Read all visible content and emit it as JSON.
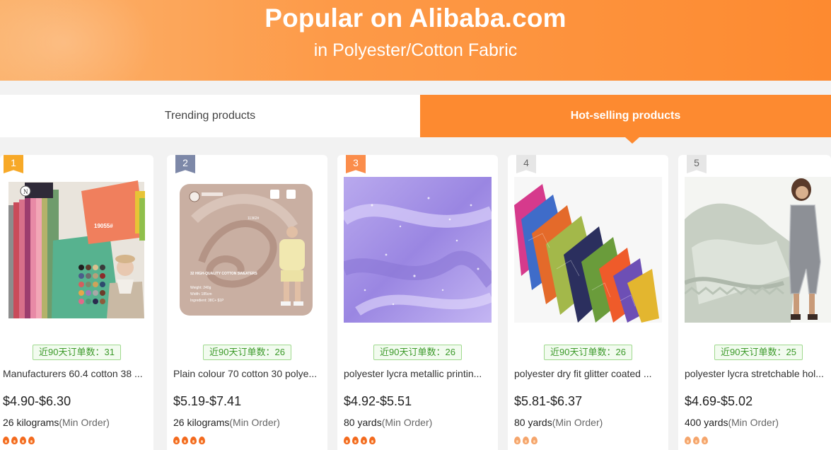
{
  "banner": {
    "title": "Popular on Alibaba.com",
    "subtitle": "in Polyester/Cotton Fabric"
  },
  "tabs": [
    {
      "label": "Trending products",
      "active": false
    },
    {
      "label": "Hot-selling products",
      "active": true
    }
  ],
  "colors": {
    "accent": "#fd8a30",
    "badge_green": "#3c9a2a",
    "flame": "#f36a1e"
  },
  "products": [
    {
      "rank": "1",
      "orders": "近90天订单数：31",
      "title": "Manufacturers 60.4 cotton 38 ...",
      "price": "$4.90-$6.30",
      "min_qty": "26 kilograms",
      "min_label": "(Min Order)",
      "flames": 4
    },
    {
      "rank": "2",
      "orders": "近90天订单数：26",
      "title": "Plain colour 70 cotton 30 polye...",
      "price": "$5.19-$7.41",
      "min_qty": "26 kilograms",
      "min_label": "(Min Order)",
      "flames": 4,
      "image_text": {
        "code": "11362#",
        "heading": "32 HIGH-QUALITY COTTON SWEATERS",
        "weight": "Weight:  240g",
        "width": "Width:  185cm",
        "ingredient": "Ingredient:  38C+ $1P"
      }
    },
    {
      "rank": "3",
      "orders": "近90天订单数：26",
      "title": "polyester lycra metallic printin...",
      "price": "$4.92-$5.51",
      "min_qty": "80 yards",
      "min_label": "(Min Order)",
      "flames": 4
    },
    {
      "rank": "4",
      "orders": "近90天订单数：26",
      "title": "polyester dry fit glitter coated ...",
      "price": "$5.81-$6.37",
      "min_qty": "80 yards",
      "min_label": "(Min Order)",
      "flames": 3
    },
    {
      "rank": "5",
      "orders": "近90天订单数：25",
      "title": "polyester lycra stretchable hol...",
      "price": "$4.69-$5.02",
      "min_qty": "400 yards",
      "min_label": "(Min Order)",
      "flames": 3
    }
  ],
  "product_1_image": {
    "code": "19055#"
  }
}
